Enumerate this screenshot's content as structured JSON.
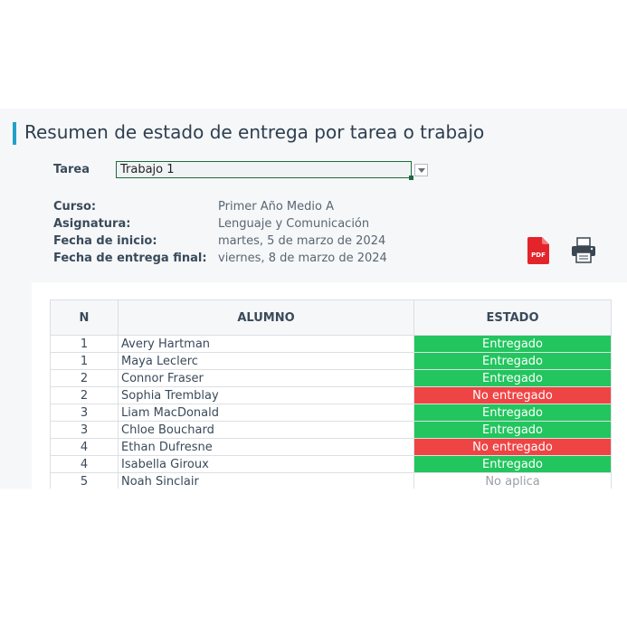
{
  "header": {
    "title": "Resumen de estado de entrega por tarea o trabajo"
  },
  "filter": {
    "tarea_label": "Tarea",
    "tarea_value": "Trabajo 1"
  },
  "info": {
    "curso_label": "Curso:",
    "curso_value": "Primer Año Medio A",
    "asignatura_label": "Asignatura:",
    "asignatura_value": "Lenguaje y Comunicación",
    "inicio_label": "Fecha de inicio:",
    "inicio_value": "martes, 5 de marzo de 2024",
    "entrega_label": "Fecha de entrega final:",
    "entrega_value": "viernes, 8 de marzo de 2024"
  },
  "actions": {
    "pdf_icon": "pdf-icon",
    "pdf_text": "PDF",
    "print_icon": "printer-icon"
  },
  "colors": {
    "accent": "#22a0c6",
    "entregado": "#22c55e",
    "no_entregado": "#ef4444"
  },
  "table": {
    "headers": [
      "N",
      "ALUMNO",
      "ESTADO"
    ],
    "rows": [
      {
        "n": "1",
        "name": "Avery Hartman",
        "status": "Entregado",
        "kind": "ok"
      },
      {
        "n": "1",
        "name": "Maya Leclerc",
        "status": "Entregado",
        "kind": "ok"
      },
      {
        "n": "2",
        "name": "Connor Fraser",
        "status": "Entregado",
        "kind": "ok"
      },
      {
        "n": "2",
        "name": "Sophia Tremblay",
        "status": "No entregado",
        "kind": "bad"
      },
      {
        "n": "3",
        "name": "Liam MacDonald",
        "status": "Entregado",
        "kind": "ok"
      },
      {
        "n": "3",
        "name": "Chloe Bouchard",
        "status": "Entregado",
        "kind": "ok"
      },
      {
        "n": "4",
        "name": "Ethan Dufresne",
        "status": "No entregado",
        "kind": "bad"
      },
      {
        "n": "4",
        "name": "Isabella Giroux",
        "status": "Entregado",
        "kind": "ok"
      },
      {
        "n": "5",
        "name": "Noah Sinclair",
        "status": "No aplica",
        "kind": "na"
      }
    ]
  }
}
